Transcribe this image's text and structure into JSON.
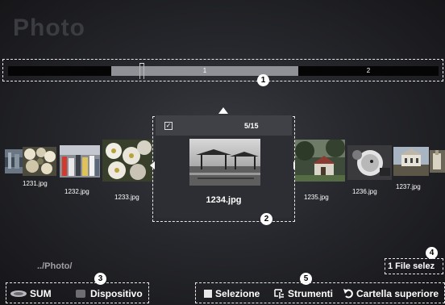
{
  "header": {
    "title": "Photo"
  },
  "timeline": {
    "segments": [
      "1",
      "2"
    ]
  },
  "callouts": [
    "1",
    "2",
    "3",
    "4",
    "5"
  ],
  "thumbnails": [
    {
      "name": "1231.jpg"
    },
    {
      "name": "1232.jpg"
    },
    {
      "name": "1233.jpg"
    },
    {
      "name": "1235.jpg"
    },
    {
      "name": "1236.jpg"
    },
    {
      "name": "1237.jpg"
    }
  ],
  "focused": {
    "check_mark": "✓",
    "counter": "5/15",
    "name": "1234.jpg"
  },
  "status": {
    "path": "../Photo/",
    "selected": "1 File selez"
  },
  "bottom": {
    "sum_label": "SUM",
    "device_label": "Dispositivo",
    "selection_label": "Selezione",
    "tools_label": "Strumenti",
    "parent_label": "Cartella superiore"
  }
}
